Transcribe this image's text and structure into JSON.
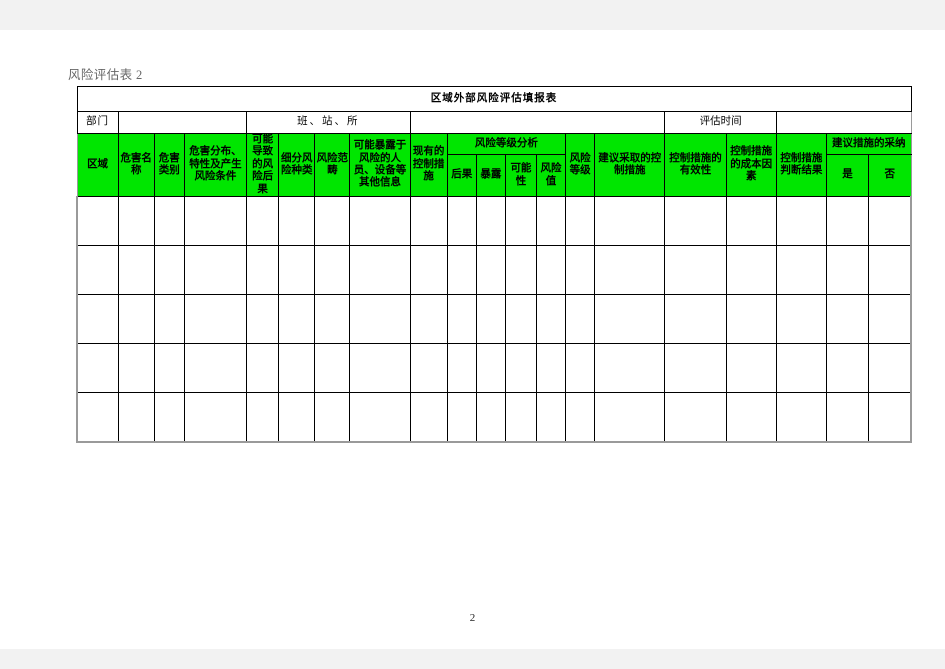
{
  "document": {
    "label": "风险评估表 2",
    "page_number": "2"
  },
  "table": {
    "title": "区域外部风险评估填报表",
    "meta_row": {
      "department_label": "部门",
      "department_value": "",
      "team_label": "班、站、所",
      "team_value": "",
      "eval_time_label": "评估时间",
      "eval_time_value": ""
    },
    "headers": {
      "area": "区域",
      "hazard_name": "危害名称",
      "hazard_category": "危害类别",
      "hazard_distribution": "危害分布、特性及产生风险条件",
      "possible_consequence": "可能导致的风险后果",
      "risk_subtype": "细分风险种类",
      "risk_scope": "风险范畴",
      "exposed_info": "可能暴露于风险的人员、设备等其他信息",
      "existing_controls": "现有的控制措施",
      "risk_level_analysis": "风险等级分析",
      "consequence": "后果",
      "exposure": "暴露",
      "likelihood": "可能性",
      "risk_value": "风险值",
      "risk_grade": "风险等级",
      "suggested_controls": "建议采取的控制措施",
      "control_effectiveness": "控制措施的有效性",
      "control_cost_factor": "控制措施的成本因素",
      "control_judgement": "控制措施判断结果",
      "adoption": "建议措施的采纳",
      "adoption_yes": "是",
      "adoption_no": "否"
    },
    "rows": [
      {
        "cells": [
          "",
          "",
          "",
          "",
          "",
          "",
          "",
          "",
          "",
          "",
          "",
          "",
          "",
          "",
          "",
          "",
          "",
          "",
          "",
          ""
        ]
      },
      {
        "cells": [
          "",
          "",
          "",
          "",
          "",
          "",
          "",
          "",
          "",
          "",
          "",
          "",
          "",
          "",
          "",
          "",
          "",
          "",
          "",
          ""
        ]
      },
      {
        "cells": [
          "",
          "",
          "",
          "",
          "",
          "",
          "",
          "",
          "",
          "",
          "",
          "",
          "",
          "",
          "",
          "",
          "",
          "",
          "",
          ""
        ]
      },
      {
        "cells": [
          "",
          "",
          "",
          "",
          "",
          "",
          "",
          "",
          "",
          "",
          "",
          "",
          "",
          "",
          "",
          "",
          "",
          "",
          "",
          ""
        ]
      },
      {
        "cells": [
          "",
          "",
          "",
          "",
          "",
          "",
          "",
          "",
          "",
          "",
          "",
          "",
          "",
          "",
          "",
          "",
          "",
          "",
          "",
          ""
        ]
      }
    ]
  },
  "colors": {
    "header_green": "#00e600",
    "label_gray": "#666666",
    "grid_black": "#000000",
    "outer_gray": "#9a9a9a"
  }
}
